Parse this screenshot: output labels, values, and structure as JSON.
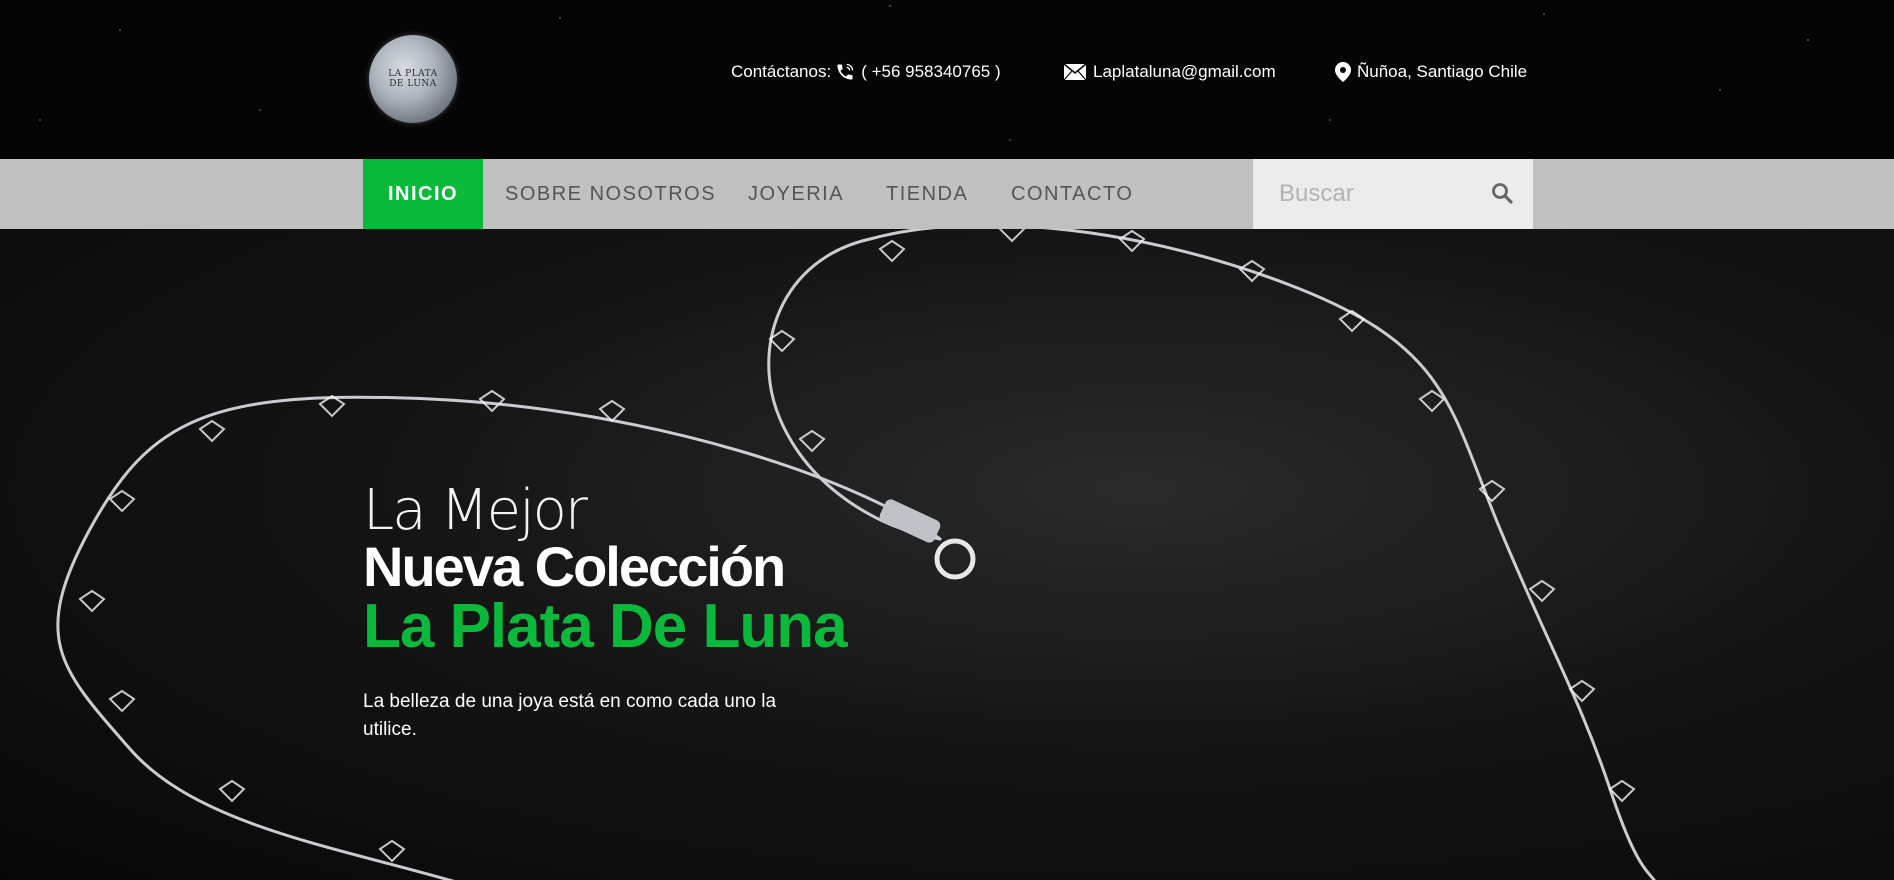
{
  "header": {
    "logo_text": "LA PLATA DE LUNA",
    "contact_label": "Contáctanos:",
    "phone": "( +56 958340765 )",
    "email": "Laplataluna@gmail.com",
    "location": "Ñuñoa, Santiago Chile",
    "icons": [
      "phone-icon",
      "mail-icon",
      "location-pin-icon"
    ]
  },
  "nav": {
    "items": [
      {
        "label": "INICIO",
        "active": true
      },
      {
        "label": "SOBRE NOSOTROS",
        "active": false
      },
      {
        "label": "JOYERIA",
        "active": false
      },
      {
        "label": "TIENDA",
        "active": false
      },
      {
        "label": "CONTACTO",
        "active": false
      }
    ],
    "search_placeholder": "Buscar"
  },
  "hero": {
    "line1": "La Mejor",
    "line2": "Nueva Colección",
    "line3": "La Plata De Luna",
    "description": "La belleza de una joya está en como cada uno la utilice."
  },
  "colors": {
    "accent": "#0ab93b",
    "nav_bg": "#c0c0c0",
    "header_bg": "#050505"
  }
}
